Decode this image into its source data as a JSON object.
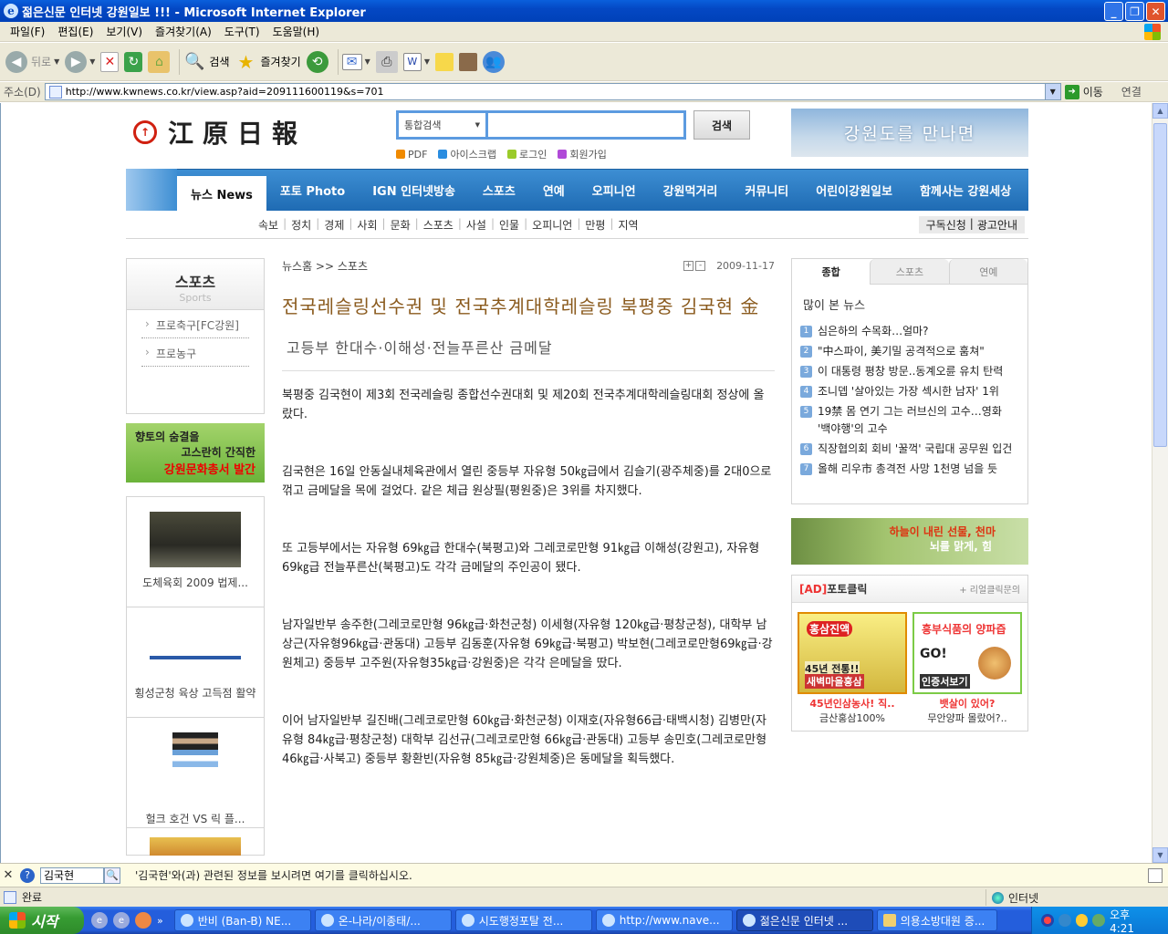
{
  "window": {
    "title": "젊은신문 인터넷 강원일보 !!! - Microsoft Internet Explorer",
    "min": "_",
    "max": "❐",
    "close": "✕"
  },
  "menu": [
    "파일(F)",
    "편집(E)",
    "보기(V)",
    "즐겨찾기(A)",
    "도구(T)",
    "도움말(H)"
  ],
  "toolbar": {
    "back": "뒤로",
    "search": "검색",
    "favorites": "즐겨찾기"
  },
  "address": {
    "label": "주소(D)",
    "url": "http://www.kwnews.co.kr/view.asp?aid=209111600119&s=701",
    "go": "이동",
    "links": "연결"
  },
  "site": {
    "logo_text": "江原日報",
    "search": {
      "scope": "통합검색",
      "button": "검색"
    },
    "quicklinks": [
      {
        "label": "PDF",
        "color": "#f08a00"
      },
      {
        "label": "아이스크랩",
        "color": "#2a8de0"
      },
      {
        "label": "로그인",
        "color": "#9acb2a"
      },
      {
        "label": "회원가입",
        "color": "#b04ad8"
      }
    ],
    "top_banner": "강원도를 만나면",
    "gnb": [
      "뉴스 News",
      "포토 Photo",
      "IGN 인터넷방송",
      "스포츠",
      "연예",
      "오피니언",
      "강원먹거리",
      "커뮤니티",
      "어린이강원일보",
      "함께사는 강원세상"
    ],
    "subnav": [
      "속보",
      "정치",
      "경제",
      "사회",
      "문화",
      "스포츠",
      "사설",
      "인물",
      "오피니언",
      "만평",
      "지역"
    ],
    "subnav_right": [
      "구독신청",
      "광고안내"
    ]
  },
  "left": {
    "section_ko": "스포츠",
    "section_en": "Sports",
    "items": [
      "프로축구[FC강원]",
      "프로농구"
    ],
    "culture_ad": [
      "향토의 숨결을",
      "고스란히 간직한",
      "강원문화총서 발간"
    ],
    "photos": [
      {
        "caption": "도체육회 2009 법제..."
      },
      {
        "caption": "횡성군청 육상 고득점 활약"
      },
      {
        "caption": "헐크 호건 VS 릭 플..."
      }
    ]
  },
  "article": {
    "breadcrumb": "뉴스홈 >> 스포츠",
    "zoom_in": "+",
    "zoom_out": "-",
    "date": "2009-11-17",
    "headline": "전국레슬링선수권 및 전국추계대학레슬링 북평중 김국현 金",
    "subhead": "고등부 한대수·이해성·전늘푸른산 금메달",
    "paragraphs": [
      "북평중 김국현이 제3회 전국레슬링 종합선수권대회 및 제20회 전국추계대학레슬링대회 정상에 올랐다.",
      "김국현은 16일 안동실내체육관에서 열린 중등부 자유형 50㎏급에서 김슬기(광주체중)를 2대0으로 꺾고 금메달을 목에 걸었다. 같은 체급 원상필(평원중)은 3위를 차지했다.",
      "또 고등부에서는 자유형 69㎏급 한대수(북평고)와 그레코로만형 91㎏급 이해성(강원고), 자유형 69㎏급 전늘푸른산(북평고)도 각각 금메달의 주인공이 됐다.",
      "남자일반부 송주한(그레코로만형 96㎏급·화천군청) 이세형(자유형 120㎏급·평창군청), 대학부 남상근(자유형96㎏급·관동대) 고등부 김동훈(자유형 69㎏급·북평고) 박보현(그레코로만형69㎏급·강원체고) 중등부 고주원(자유형35㎏급·강원중)은 각각 은메달을 땄다.",
      "이어 남자일반부 길진배(그레코로만형 60㎏급·화천군청) 이재호(자유형66급·태백시청) 김병만(자유형 84㎏급·평창군청) 대학부 김선규(그레코로만형 66㎏급·관동대) 고등부 송민호(그레코로만형 46㎏급·사북고) 중등부 황환빈(자유형 85㎏급·강원체중)은 동메달을 획득했다."
    ]
  },
  "right": {
    "tabs": [
      "종합",
      "스포츠",
      "연예"
    ],
    "popular_title": "많이 본 뉴스",
    "popular": [
      "심은하의 수목화…얼마?",
      "\"中스파이, 美기밀 공격적으로 훔쳐\"",
      "이 대통령 평창 방문..동계오륜 유치 탄력",
      "조니뎁 '살아있는 가장 섹시한 남자' 1위",
      "19禁 몸 연기 그는 러브신의 고수…영화 '백야행'의 고수",
      "직장협의회 회비 '꿀꺽' 국립대 공무원 입건",
      "올해 리우市 총격전 사망 1천명 넘을 듯"
    ],
    "herb_ad": [
      "하늘이 내린 선물, 천마",
      "뇌를 맑게, 힘"
    ],
    "adbox_title_ad": "[AD]",
    "adbox_title": "포토클릭",
    "adbox_more": "+ 리얼클릭문의",
    "ads": [
      {
        "tag": "홍삼진액",
        "line": "45년 전통!!",
        "band": "새벽마을홍삼",
        "cap1": "45년인삼농사! 직..",
        "cap2": "금산홍삼100%"
      },
      {
        "tag": "흥부식품의 양파즙",
        "line": "GO!",
        "band": "인증서보기",
        "cap1": "뱃살이 있어?",
        "cap2": "무안양파 몰랐어?.."
      }
    ]
  },
  "findbar": {
    "close": "✕",
    "term": "김국현",
    "message": "'김국현'와(과) 관련된 정보를 보시려면 여기를 클릭하십시오."
  },
  "status": {
    "text": "완료",
    "zone": "인터넷"
  },
  "taskbar": {
    "start": "시작",
    "tasks": [
      "반비 (Ban-B) NE...",
      "온-나라/이종태/...",
      "시도행정포탈 전...",
      "http://www.nave...",
      "젊은신문 인터넷 ...",
      "의용소방대원 증..."
    ],
    "active_index": 4,
    "clock": "오후 4:21"
  },
  "colors": {
    "headline": "#8a5a1d",
    "gnb": "#1f6bb3",
    "title_bar": "#0448c4"
  }
}
